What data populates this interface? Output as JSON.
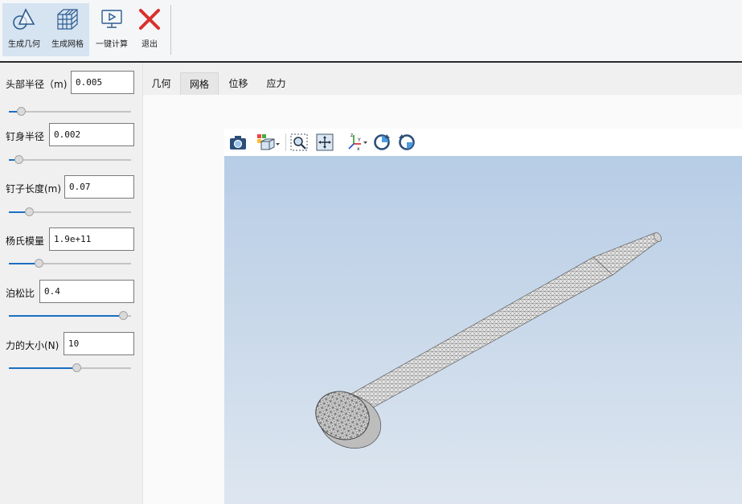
{
  "ribbon": {
    "buttons": [
      {
        "label": "生成几何",
        "icon": "geometry-icon"
      },
      {
        "label": "生成网格",
        "icon": "mesh-cube-icon"
      },
      {
        "label": "一键计算",
        "icon": "play-screen-icon"
      },
      {
        "label": "退出",
        "icon": "close-x-icon"
      }
    ]
  },
  "params": [
    {
      "label": "头部半径（m)",
      "value": "0.005",
      "slider_fraction": 0.07
    },
    {
      "label": "钉身半径",
      "value": "0.002",
      "slider_fraction": 0.05
    },
    {
      "label": "钉子长度(m)",
      "value": "0.07",
      "slider_fraction": 0.14
    },
    {
      "label": "杨氏模量",
      "value": "1.9e+11",
      "slider_fraction": 0.23
    },
    {
      "label": "泊松比",
      "value": "0.4",
      "slider_fraction": 0.97
    },
    {
      "label": "力的大小(N)",
      "value": "10",
      "slider_fraction": 0.56
    }
  ],
  "tabs": [
    {
      "label": "几何"
    },
    {
      "label": "网格",
      "active": true
    },
    {
      "label": "位移"
    },
    {
      "label": "应力"
    }
  ],
  "viewer_tools": [
    {
      "icon": "camera-icon"
    },
    {
      "icon": "view-cube-dropdown-icon"
    },
    {
      "icon": "zoom-box-icon"
    },
    {
      "icon": "fit-all-icon"
    },
    {
      "icon": "axes-xyz-dropdown-icon"
    },
    {
      "icon": "rotate-ccw-icon"
    },
    {
      "icon": "rotate-cw-icon"
    }
  ],
  "colors": {
    "accent": "#1b6fc1",
    "viewport_top": "#b7cde6",
    "viewport_bottom": "#dde6f0",
    "exit_red": "#d9302c"
  }
}
